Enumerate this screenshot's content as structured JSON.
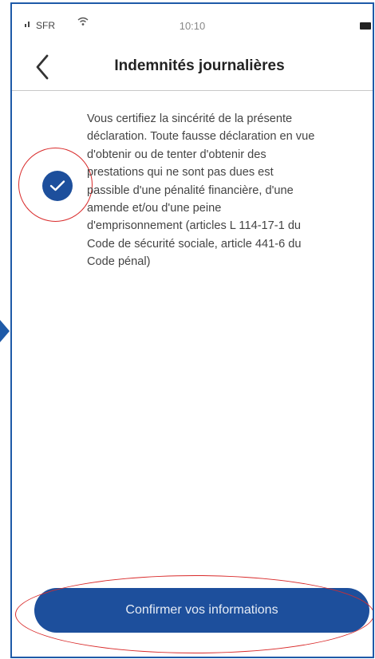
{
  "status_bar": {
    "carrier": "SFR",
    "time": "10:10",
    "icons": [
      "signal-icon",
      "wifi-icon",
      "battery-icon"
    ]
  },
  "nav": {
    "title": "Indemnités journalières",
    "back_icon": "chevron-left-icon"
  },
  "certification": {
    "checked": true,
    "text": "Vous certifiez la sincérité de la présente\ndéclaration. Toute fausse déclaration en vue\nd'obtenir ou de tenter d'obtenir des\nprestations qui ne sont pas dues est\npassible d'une pénalité financière, d'une\namende et/ou d'une peine\nd'emprisonnement (articles L 114-17-1 du\nCode de sécurité sociale, article 441-6 du\nCode pénal)"
  },
  "confirm_button": {
    "label": "Confirmer vos informations"
  },
  "colors": {
    "accent": "#1d4f9c",
    "annotation": "#d92b2b",
    "frame": "#1e5aa8"
  }
}
